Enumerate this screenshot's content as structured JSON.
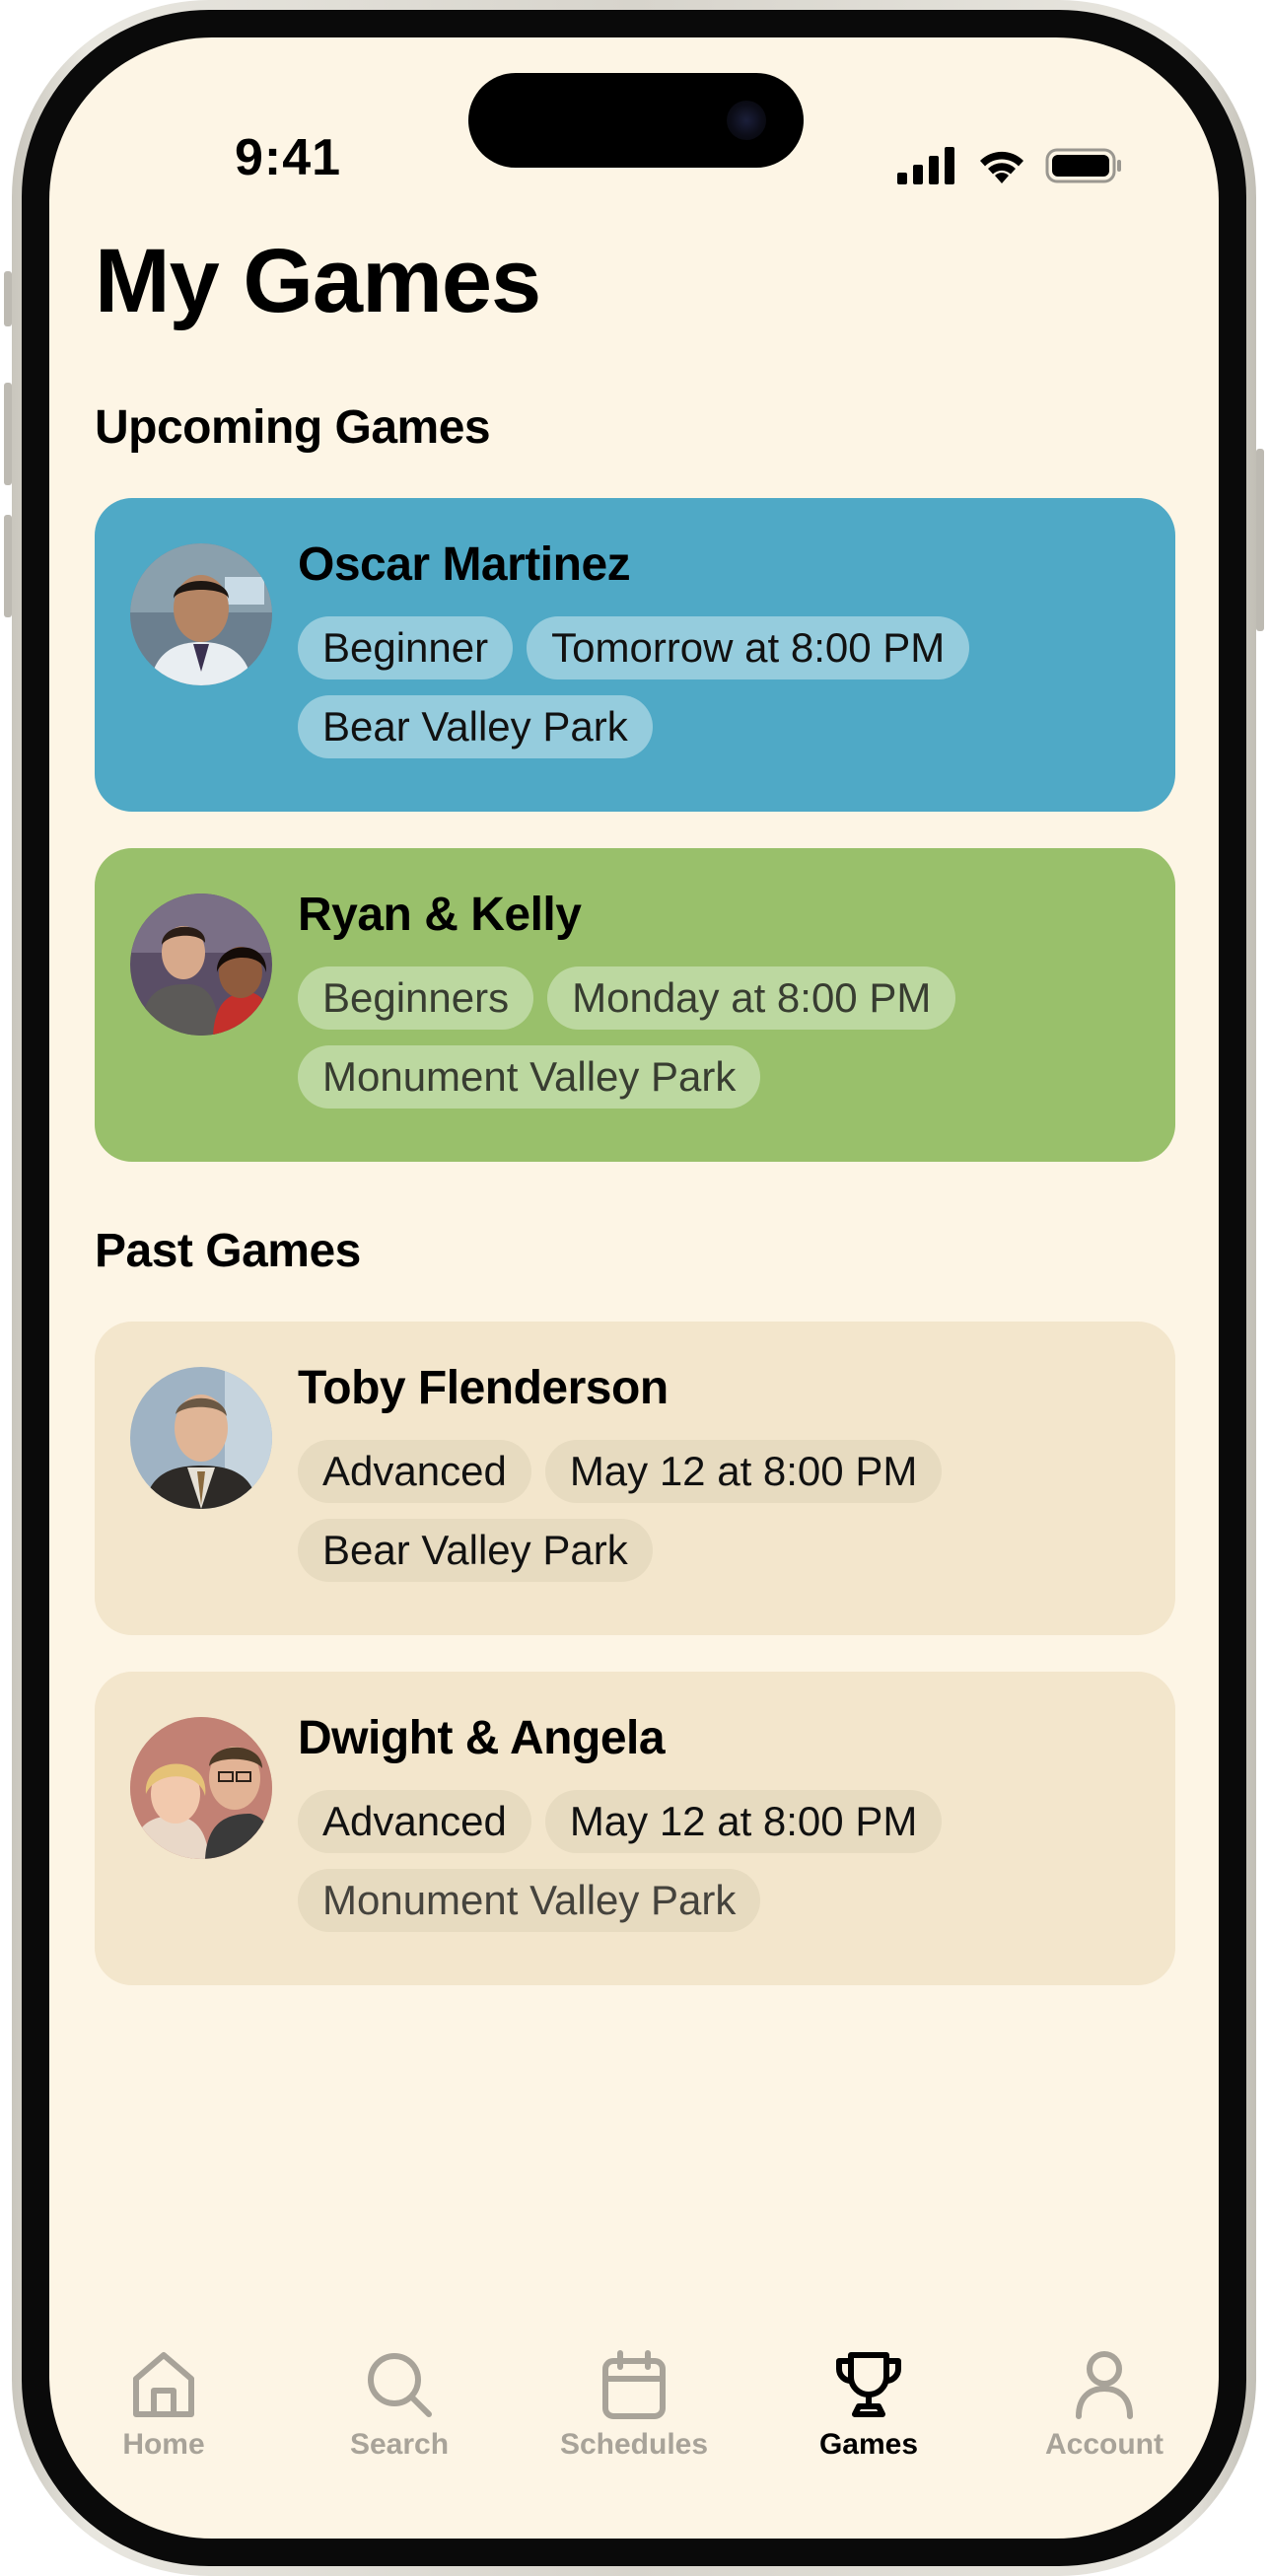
{
  "status_bar": {
    "time": "9:41"
  },
  "page_title": "My Games",
  "sections": {
    "upcoming": "Upcoming Games",
    "past": "Past Games"
  },
  "games": [
    {
      "name": "Oscar Martinez",
      "level": "Beginner",
      "when": "Tomorrow at 8:00 PM",
      "location": "Bear Valley Park",
      "color": "#4fa9c6"
    },
    {
      "name": "Ryan & Kelly",
      "level": "Beginners",
      "when": "Monday at 8:00 PM",
      "location": "Monument Valley Park",
      "color": "#99c06b"
    },
    {
      "name": "Toby Flenderson",
      "level": "Advanced",
      "when": "May 12 at 8:00 PM",
      "location": "Bear Valley Park",
      "color": "#f3e6cc"
    },
    {
      "name": "Dwight & Angela",
      "level": "Advanced",
      "when": "May 12 at 8:00 PM",
      "location": "Monument Valley Park",
      "color": "#f3e6cc"
    }
  ],
  "tabbar": {
    "items": [
      {
        "label": "Home",
        "icon": "home-icon"
      },
      {
        "label": "Search",
        "icon": "search-icon"
      },
      {
        "label": "Schedules",
        "icon": "calendar-icon"
      },
      {
        "label": "Games",
        "icon": "trophy-icon",
        "active": true
      },
      {
        "label": "Account",
        "icon": "person-icon"
      }
    ]
  }
}
